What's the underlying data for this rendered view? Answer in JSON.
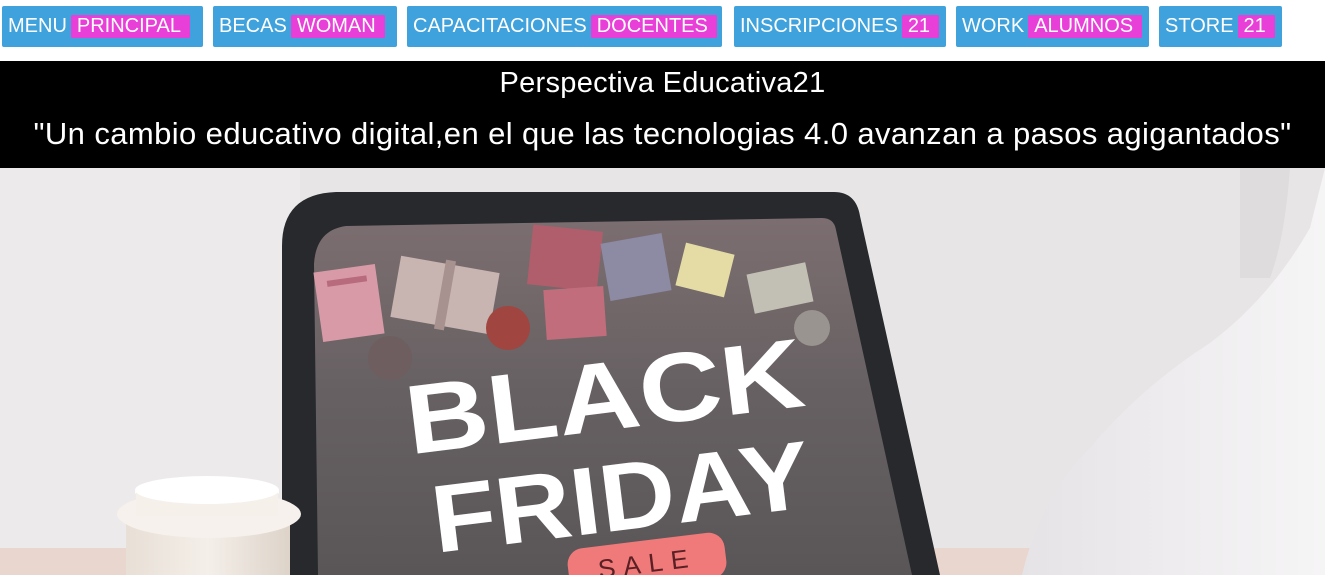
{
  "nav": {
    "items": [
      {
        "word1": "MENU",
        "word2": "PRINCIPAL"
      },
      {
        "word1": "BECAS",
        "word2": "WOMAN"
      },
      {
        "word1": "CAPACITACIONES",
        "word2": "DOCENTES"
      },
      {
        "word1": "INSCRIPCIONES",
        "word2": "21"
      },
      {
        "word1": "WORK",
        "word2": "ALUMNOS"
      },
      {
        "word1": "STORE",
        "word2": "21"
      }
    ]
  },
  "header": {
    "title": "Perspectiva Educativa21",
    "slogan": "\"Un cambio educativo digital,en el que las tecnologias 4.0 avanzan a pasos agigantados\""
  },
  "hero": {
    "line1": "BLACK",
    "line2": "FRIDAY",
    "tag": "SALE"
  },
  "colors": {
    "nav_button": "#3fa2dd",
    "nav_highlight": "#e83fd8",
    "banner_bg": "#000000",
    "tag_bg": "#f07a7a"
  }
}
